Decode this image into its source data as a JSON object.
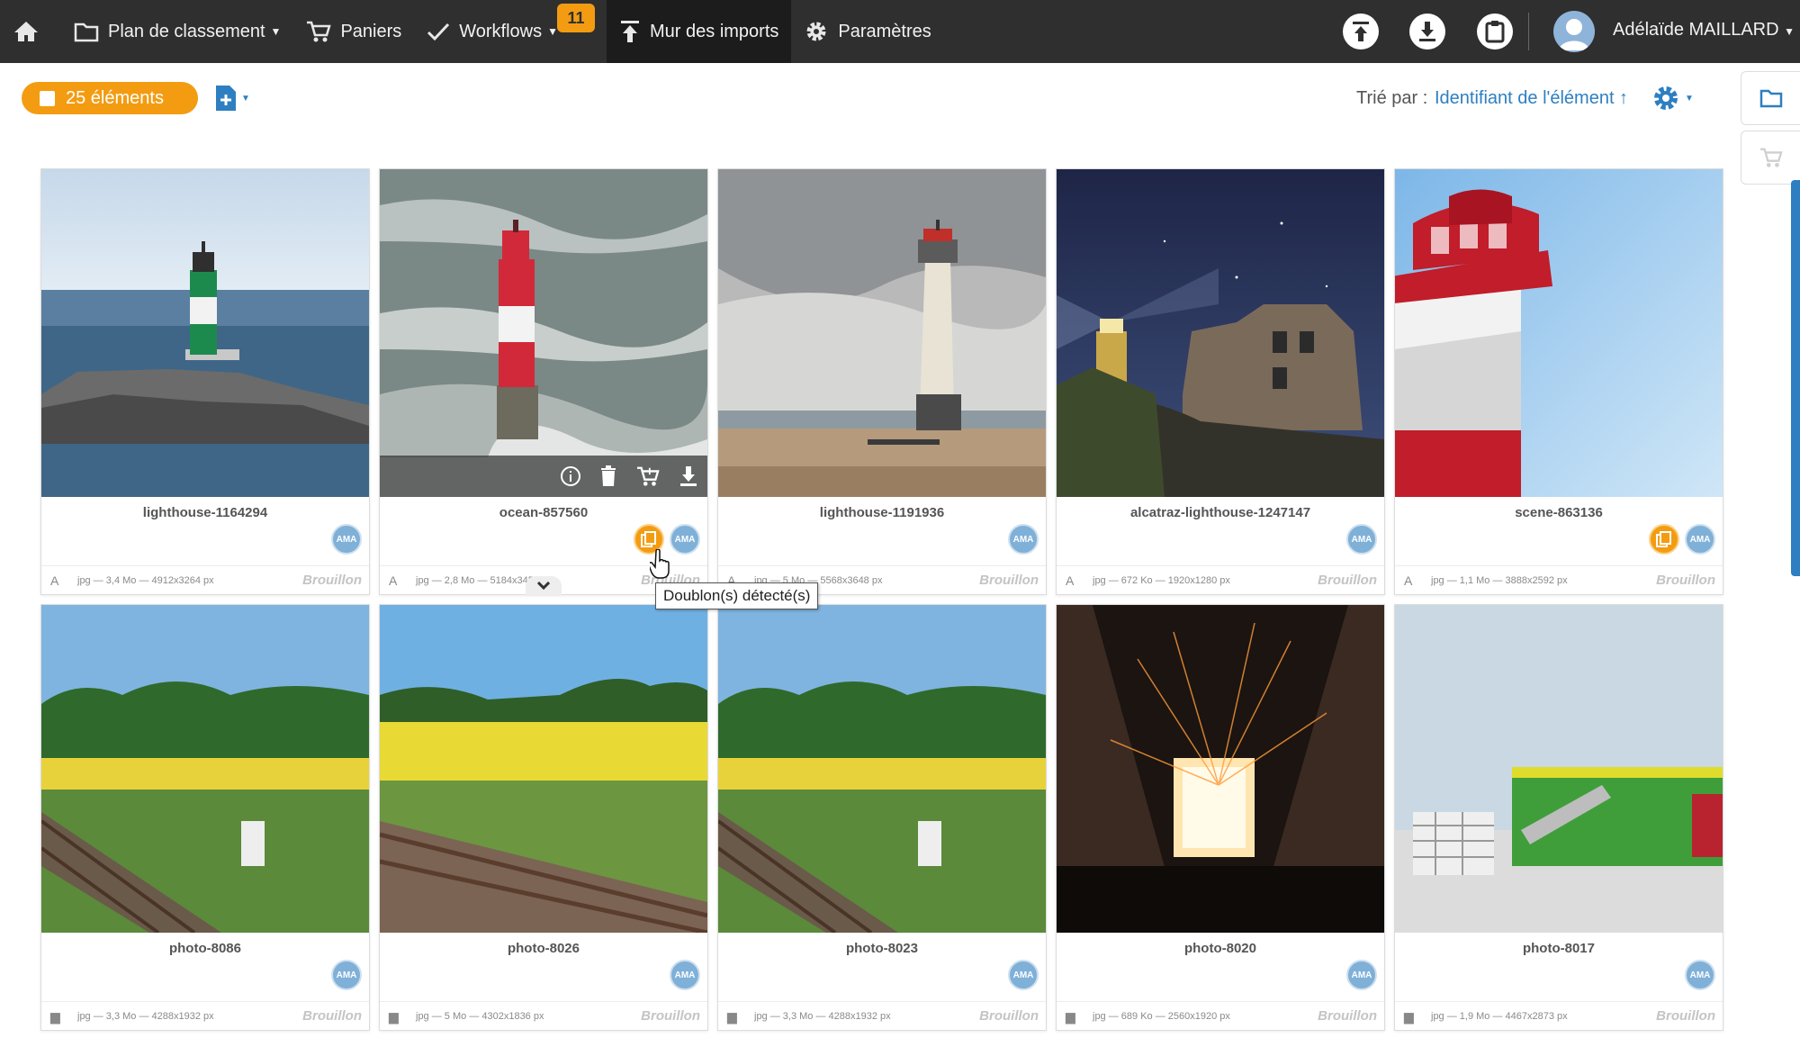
{
  "nav": {
    "plan": "Plan de classement",
    "paniers": "Paniers",
    "workflows": "Workflows",
    "workflows_badge": "11",
    "mur": "Mur des imports",
    "parametres": "Paramètres",
    "user": "Adélaïde MAILLARD"
  },
  "toolbar": {
    "count": "25 éléments",
    "sort_label": "Trié par :",
    "sort_value": "Identifiant de l'élément ↑"
  },
  "tooltip": "Doublon(s) détecté(s)",
  "status_label": "Brouillon",
  "owner_initials": "AMA",
  "cards": [
    {
      "name": "lighthouse-1164294",
      "meta": "jpg — 3,4 Mo — 4912x3264 px"
    },
    {
      "name": "ocean-857560",
      "meta": "jpg — 2,8 Mo — 5184x3456 px"
    },
    {
      "name": "lighthouse-1191936",
      "meta": "jpg — 5 Mo — 5568x3648 px"
    },
    {
      "name": "alcatraz-lighthouse-1247147",
      "meta": "jpg — 672 Ko — 1920x1280 px"
    },
    {
      "name": "scene-863136",
      "meta": "jpg — 1,1 Mo — 3888x2592 px"
    },
    {
      "name": "photo-8086",
      "meta": "jpg — 3,3 Mo — 4288x1932 px"
    },
    {
      "name": "photo-8026",
      "meta": "jpg — 5 Mo — 4302x1836 px"
    },
    {
      "name": "photo-8023",
      "meta": "jpg — 3,3 Mo — 4288x1932 px"
    },
    {
      "name": "photo-8020",
      "meta": "jpg — 689 Ko — 2560x1920 px"
    },
    {
      "name": "photo-8017",
      "meta": "jpg — 1,9 Mo — 4467x2873 px"
    }
  ],
  "colors": {
    "accent": "#f39c12",
    "link": "#2d7fc1",
    "topbar": "#2f2f2f"
  }
}
